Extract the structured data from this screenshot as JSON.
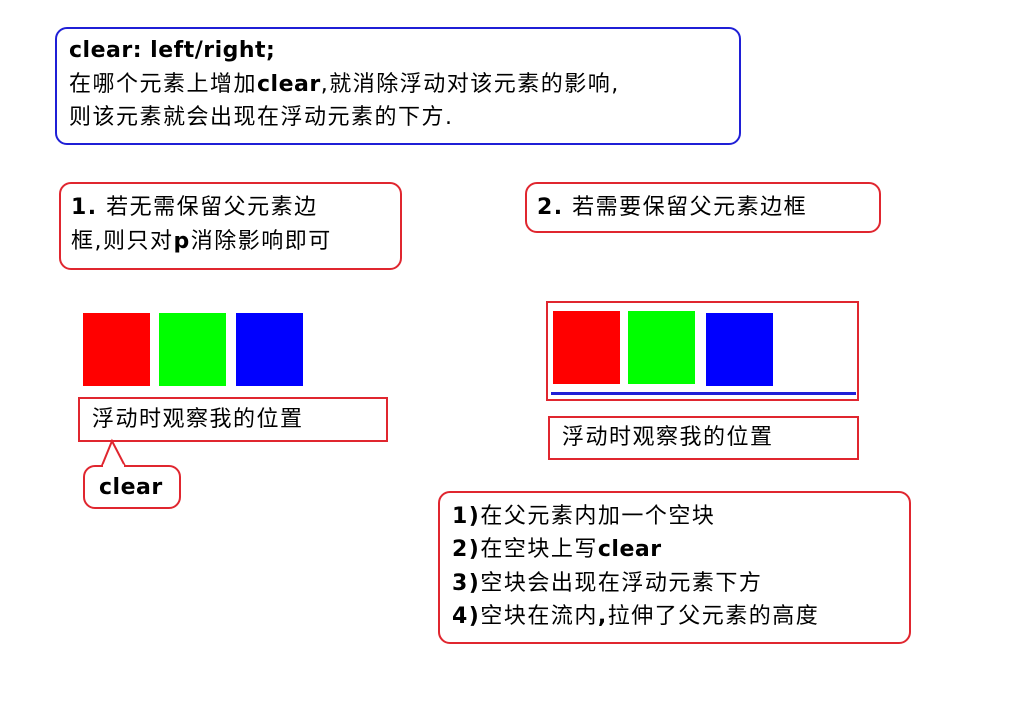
{
  "intro": {
    "title": "clear: left/right;",
    "line1_pre": "在哪个元素上增加",
    "line1_kw": "clear",
    "line1_post": ",就消除浮动对该元素的影响,",
    "line2": "则该元素就会出现在浮动元素的下方."
  },
  "case1": {
    "num": "1.",
    "line1": " 若无需保留父元素边",
    "line2_pre": "框,则只对",
    "line2_kw": "p",
    "line2_post": "消除影响即可",
    "paragraph": "浮动时观察我的位置",
    "callout": "clear"
  },
  "case2": {
    "num": "2.",
    "line1": " 若需要保留父元素边框",
    "paragraph": "浮动时观察我的位置"
  },
  "steps": [
    {
      "num": "1)",
      "pre": "在父元素内加一个空块",
      "kw": "",
      "post": ""
    },
    {
      "num": "2)",
      "pre": "在空块上写",
      "kw": "clear",
      "post": ""
    },
    {
      "num": "3)",
      "pre": "空块会出现在浮动元素下方",
      "kw": "",
      "post": ""
    },
    {
      "num": "4)",
      "pre": "空块在流内",
      "kw": ",",
      "post": "拉伸了父元素的高度"
    }
  ],
  "colors": {
    "red_block": "#ff0000",
    "green_block": "#00ff00",
    "blue_block": "#0000ff",
    "frame_red": "#e0262f",
    "frame_blue": "#1f1fd6"
  }
}
